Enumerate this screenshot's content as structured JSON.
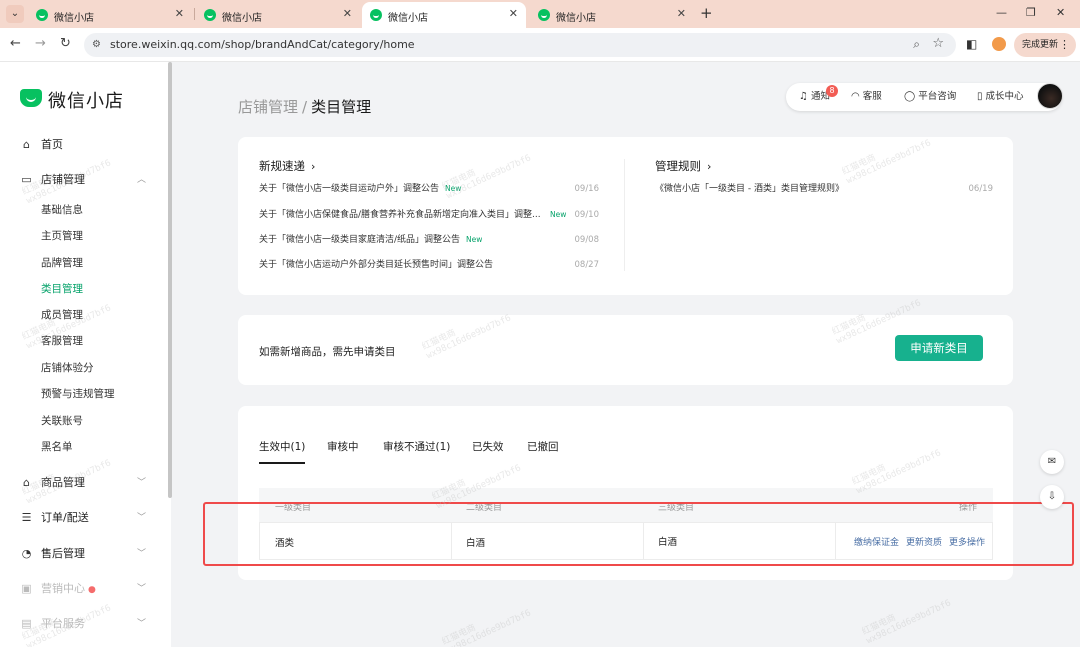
{
  "browser": {
    "tabs": [
      {
        "label": "微信小店",
        "active": false
      },
      {
        "label": "微信小店",
        "active": false
      },
      {
        "label": "微信小店",
        "active": true
      },
      {
        "label": "微信小店",
        "active": false
      }
    ],
    "url": "store.weixin.qq.com/shop/brandAndCat/category/home",
    "update_label": "完成更新"
  },
  "sidebar": {
    "logo_text": "微信小店",
    "items": [
      {
        "label": "首页",
        "icon": "home-icon"
      },
      {
        "label": "店铺管理",
        "icon": "store-icon",
        "expanded": true
      },
      {
        "label": "商品管理",
        "icon": "bag-icon"
      },
      {
        "label": "订单/配送",
        "icon": "order-icon"
      },
      {
        "label": "售后管理",
        "icon": "headset-icon"
      },
      {
        "label": "营销中心",
        "icon": "marketing-icon",
        "dot": "●"
      },
      {
        "label": "平台服务",
        "icon": "service-icon"
      }
    ],
    "sub_items": [
      {
        "label": "基础信息"
      },
      {
        "label": "主页管理"
      },
      {
        "label": "品牌管理"
      },
      {
        "label": "类目管理",
        "active": true
      },
      {
        "label": "成员管理"
      },
      {
        "label": "客服管理"
      },
      {
        "label": "店铺体验分"
      },
      {
        "label": "预警与违规管理"
      },
      {
        "label": "关联账号"
      },
      {
        "label": "黑名单"
      }
    ]
  },
  "header": {
    "breadcrumb_parent": "店铺管理",
    "breadcrumb_sep": "/",
    "breadcrumb_current": "类目管理",
    "actions": {
      "notify": "通知",
      "notify_count": "8",
      "service": "客服",
      "consult": "平台咨询",
      "growth": "成长中心"
    }
  },
  "news": {
    "title": "新规速递",
    "items": [
      {
        "title": "关于「微信小店一级类目运动户外」调整公告",
        "new": "New",
        "date": "09/16"
      },
      {
        "title": "关于「微信小店保健食品/膳食营养补充食品新增定向准入类目」调整...",
        "new": "New",
        "date": "09/10"
      },
      {
        "title": "关于「微信小店一级类目家庭清洁/纸品」调整公告",
        "new": "New",
        "date": "09/08"
      },
      {
        "title": "关于「微信小店运动户外部分类目延长预售时间」调整公告",
        "new": "",
        "date": "08/27"
      }
    ]
  },
  "rules": {
    "title": "管理规则",
    "items": [
      {
        "title": "《微信小店「一级类目 - 酒类」类目管理规则》",
        "date": "06/19"
      }
    ]
  },
  "apply": {
    "tip": "如需新增商品，需先申请类目",
    "button": "申请新类目"
  },
  "list": {
    "tabs": [
      {
        "label": "生效中(1)",
        "active": true
      },
      {
        "label": "审核中"
      },
      {
        "label": "审核不通过(1)"
      },
      {
        "label": "已失效"
      },
      {
        "label": "已撤回"
      }
    ],
    "columns": [
      "一级类目",
      "二级类目",
      "三级类目",
      "操作"
    ],
    "rows": [
      {
        "level1": "酒类",
        "level2": "白酒",
        "level3": "白酒",
        "ops": [
          "缴纳保证金",
          "更新资质",
          "更多操作"
        ]
      }
    ]
  },
  "watermark": {
    "line1": "红猫电商",
    "line2": "wx98c16d6e9bd7bf6"
  }
}
